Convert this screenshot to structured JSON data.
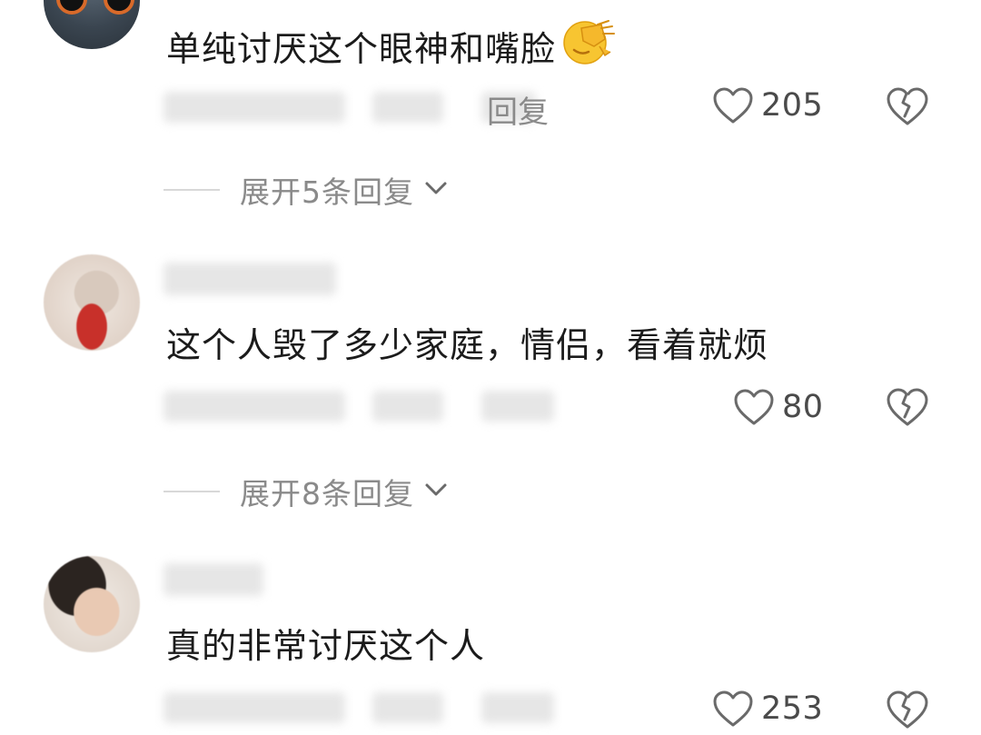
{
  "comments": [
    {
      "text": "单纯讨厌这个眼神和嘴脸",
      "emoji": "face-palm-emoji",
      "reply_label": "回复",
      "likes": "205",
      "expand_label": "展开5条回复"
    },
    {
      "text": "这个人毁了多少家庭，情侣，看着就烦",
      "likes": "80",
      "expand_label": "展开8条回复"
    },
    {
      "text": "真的非常讨厌这个人",
      "likes": "253"
    }
  ],
  "icons": {
    "like": "heart-outline-icon",
    "dislike": "broken-heart-icon",
    "expand": "chevron-down-icon"
  },
  "colors": {
    "text": "#1b1b1b",
    "meta": "#8a8a8a",
    "icon": "#6a6a6a"
  }
}
